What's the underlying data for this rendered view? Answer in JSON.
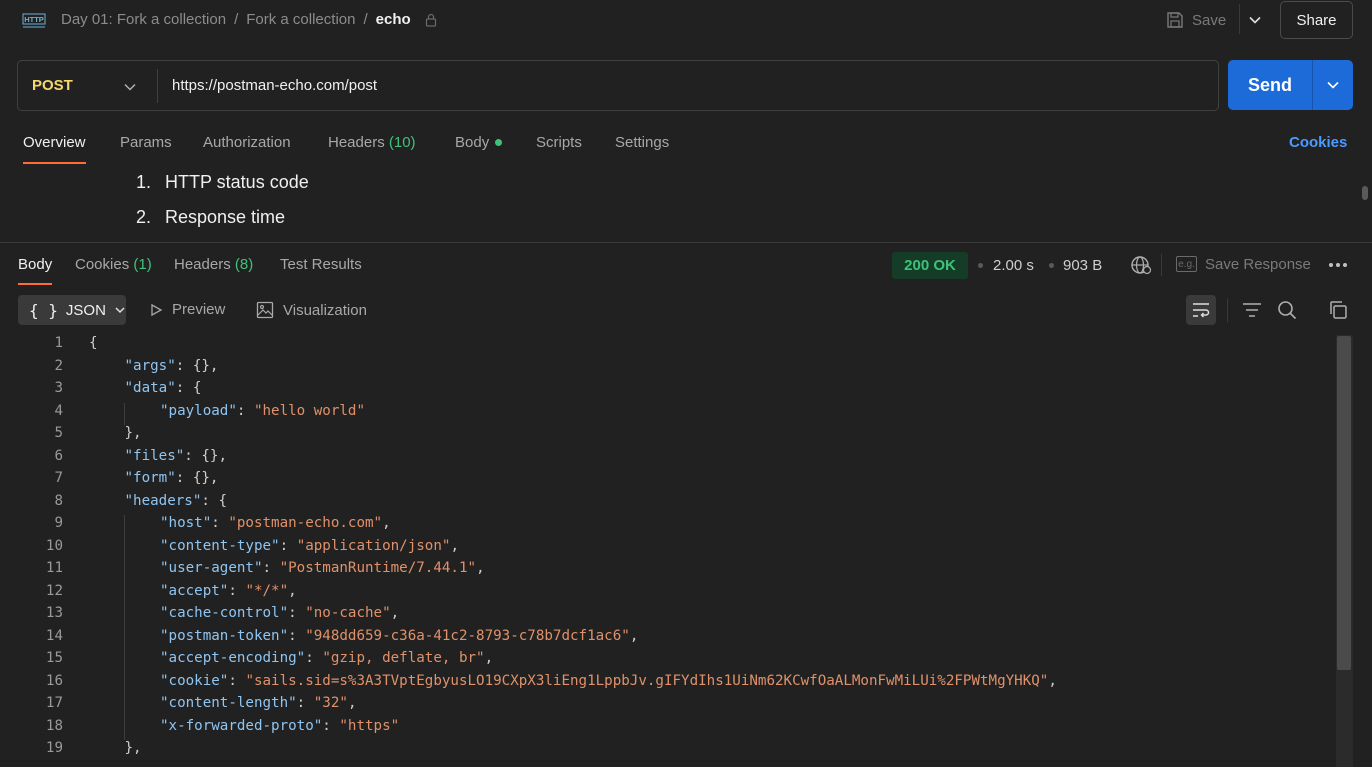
{
  "breadcrumb": {
    "items": [
      "Day 01: Fork a collection",
      "Fork a collection"
    ],
    "current": "echo",
    "separator": "/"
  },
  "toolbar": {
    "save_label": "Save",
    "share_label": "Share"
  },
  "request": {
    "method": "POST",
    "url": "https://postman-echo.com/post",
    "send_label": "Send"
  },
  "request_tabs": {
    "overview": "Overview",
    "params": "Params",
    "authorization": "Authorization",
    "headers": "Headers",
    "headers_count": "(10)",
    "body": "Body",
    "scripts": "Scripts",
    "settings": "Settings",
    "cookies": "Cookies"
  },
  "overview": {
    "items": [
      {
        "num": "1.",
        "text": "HTTP status code"
      },
      {
        "num": "2.",
        "text": "Response time"
      }
    ]
  },
  "response_tabs": {
    "body": "Body",
    "cookies": "Cookies",
    "cookies_count": "(1)",
    "headers": "Headers",
    "headers_count": "(8)",
    "test_results": "Test Results"
  },
  "response_meta": {
    "status": "200 OK",
    "time": "2.00 s",
    "size": "903 B",
    "eg_label": "e.g.",
    "save_response": "Save Response"
  },
  "format": {
    "json": "JSON",
    "braces": "{ }",
    "preview": "Preview",
    "visualization": "Visualization"
  },
  "colors": {
    "accent": "#ff6c37",
    "send": "#1c6bd8",
    "method": "#f5d76e",
    "success": "#3ec27b",
    "json_key": "#8fc5f2",
    "json_string": "#e0916a",
    "link": "#4a9bff"
  },
  "code": {
    "lines": [
      {
        "n": "1",
        "indent": 0,
        "parts": [
          [
            "pun",
            "{"
          ]
        ]
      },
      {
        "n": "2",
        "indent": 1,
        "parts": [
          [
            "key",
            "\"args\""
          ],
          [
            "pun",
            ": {},"
          ]
        ]
      },
      {
        "n": "3",
        "indent": 1,
        "parts": [
          [
            "key",
            "\"data\""
          ],
          [
            "pun",
            ": {"
          ]
        ]
      },
      {
        "n": "4",
        "indent": 2,
        "parts": [
          [
            "key",
            "\"payload\""
          ],
          [
            "pun",
            ": "
          ],
          [
            "str",
            "\"hello world\""
          ]
        ]
      },
      {
        "n": "5",
        "indent": 1,
        "parts": [
          [
            "pun",
            "},"
          ]
        ]
      },
      {
        "n": "6",
        "indent": 1,
        "parts": [
          [
            "key",
            "\"files\""
          ],
          [
            "pun",
            ": {},"
          ]
        ]
      },
      {
        "n": "7",
        "indent": 1,
        "parts": [
          [
            "key",
            "\"form\""
          ],
          [
            "pun",
            ": {},"
          ]
        ]
      },
      {
        "n": "8",
        "indent": 1,
        "parts": [
          [
            "key",
            "\"headers\""
          ],
          [
            "pun",
            ": {"
          ]
        ]
      },
      {
        "n": "9",
        "indent": 2,
        "parts": [
          [
            "key",
            "\"host\""
          ],
          [
            "pun",
            ": "
          ],
          [
            "str",
            "\"postman-echo.com\""
          ],
          [
            "pun",
            ","
          ]
        ]
      },
      {
        "n": "10",
        "indent": 2,
        "parts": [
          [
            "key",
            "\"content-type\""
          ],
          [
            "pun",
            ": "
          ],
          [
            "str",
            "\"application/json\""
          ],
          [
            "pun",
            ","
          ]
        ]
      },
      {
        "n": "11",
        "indent": 2,
        "parts": [
          [
            "key",
            "\"user-agent\""
          ],
          [
            "pun",
            ": "
          ],
          [
            "str",
            "\"PostmanRuntime/7.44.1\""
          ],
          [
            "pun",
            ","
          ]
        ]
      },
      {
        "n": "12",
        "indent": 2,
        "parts": [
          [
            "key",
            "\"accept\""
          ],
          [
            "pun",
            ": "
          ],
          [
            "str",
            "\"*/*\""
          ],
          [
            "pun",
            ","
          ]
        ]
      },
      {
        "n": "13",
        "indent": 2,
        "parts": [
          [
            "key",
            "\"cache-control\""
          ],
          [
            "pun",
            ": "
          ],
          [
            "str",
            "\"no-cache\""
          ],
          [
            "pun",
            ","
          ]
        ]
      },
      {
        "n": "14",
        "indent": 2,
        "parts": [
          [
            "key",
            "\"postman-token\""
          ],
          [
            "pun",
            ": "
          ],
          [
            "str",
            "\"948dd659-c36a-41c2-8793-c78b7dcf1ac6\""
          ],
          [
            "pun",
            ","
          ]
        ]
      },
      {
        "n": "15",
        "indent": 2,
        "parts": [
          [
            "key",
            "\"accept-encoding\""
          ],
          [
            "pun",
            ": "
          ],
          [
            "str",
            "\"gzip, deflate, br\""
          ],
          [
            "pun",
            ","
          ]
        ]
      },
      {
        "n": "16",
        "indent": 2,
        "parts": [
          [
            "key",
            "\"cookie\""
          ],
          [
            "pun",
            ": "
          ],
          [
            "str",
            "\"sails.sid=s%3A3TVptEgbyusLO19CXpX3liEng1LppbJv.gIFYdIhs1UiNm62KCwfOaALMonFwMiLUi%2FPWtMgYHKQ\""
          ],
          [
            "pun",
            ","
          ]
        ]
      },
      {
        "n": "17",
        "indent": 2,
        "parts": [
          [
            "key",
            "\"content-length\""
          ],
          [
            "pun",
            ": "
          ],
          [
            "str",
            "\"32\""
          ],
          [
            "pun",
            ","
          ]
        ]
      },
      {
        "n": "18",
        "indent": 2,
        "parts": [
          [
            "key",
            "\"x-forwarded-proto\""
          ],
          [
            "pun",
            ": "
          ],
          [
            "str",
            "\"https\""
          ]
        ]
      },
      {
        "n": "19",
        "indent": 1,
        "parts": [
          [
            "pun",
            "},"
          ]
        ]
      }
    ]
  }
}
